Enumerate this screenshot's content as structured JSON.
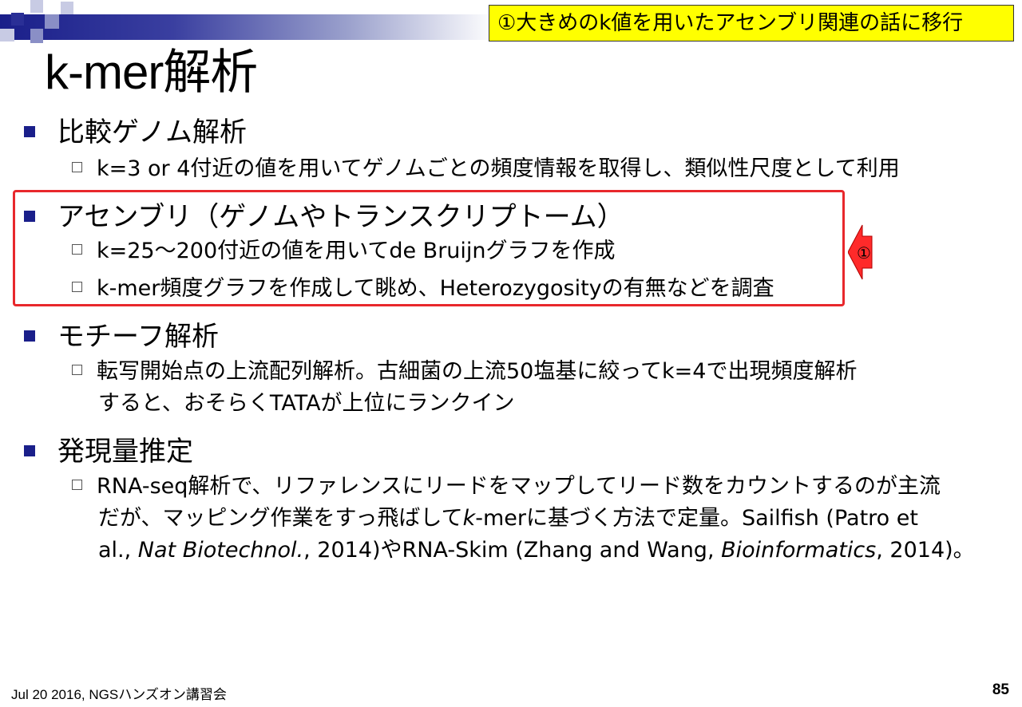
{
  "callout": "①大きめのk値を用いたアセンブリ関連の話に移行",
  "title": "k-mer解析",
  "sections": [
    {
      "heading": "比較ゲノム解析",
      "items": [
        "k=3 or 4付近の値を用いてゲノムごとの頻度情報を取得し、類似性尺度として利用"
      ]
    },
    {
      "heading": "アセンブリ（ゲノムやトランスクリプトーム）",
      "items": [
        "k=25〜200付近の値を用いてde Bruijnグラフを作成",
        "k-mer頻度グラフを作成して眺め、Heterozygosityの有無などを調査"
      ]
    },
    {
      "heading": "モチーフ解析",
      "items": [
        {
          "line1": "転写開始点の上流配列解析。古細菌の上流50塩基に絞ってk=4で出現頻度解析",
          "line2": "すると、おそらくTATAが上位にランクイン"
        }
      ]
    },
    {
      "heading": "発現量推定",
      "items": [
        {
          "line1": "RNA-seq解析で、リファレンスにリードをマップしてリード数をカウントするのが主流",
          "line2_a": "だが、マッピング作業をすっ飛ばして",
          "line2_k": "k",
          "line2_b": "-merに基づく方法で定量。Sailfish (Patro et",
          "line3_a": "al., ",
          "line3_journal1": "Nat Biotechnol.",
          "line3_b": ", 2014)やRNA-Skim (Zhang and Wang, ",
          "line3_journal2": "Bioinformatics",
          "line3_c": ", 2014)。"
        }
      ]
    }
  ],
  "arrow_label": "①",
  "footer": {
    "left": "Jul 20 2016, NGSハンズオン講習会",
    "page": "85"
  },
  "colors": {
    "accent": "#1a1f8a",
    "callout_bg": "#ffff00",
    "highlight": "#e8282c"
  }
}
